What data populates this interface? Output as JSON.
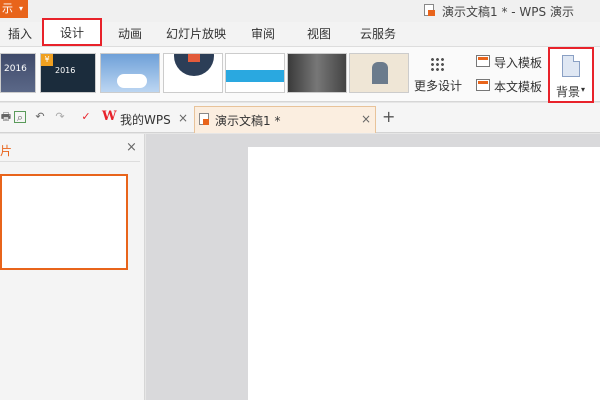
{
  "titlebar": {
    "app_button_label": "示",
    "app_button_arrow": "▾",
    "title": "演示文稿1 * - WPS 演示"
  },
  "menu": {
    "tabs": [
      {
        "label": "插入"
      },
      {
        "label": "设计"
      },
      {
        "label": "动画"
      },
      {
        "label": "幻灯片放映"
      },
      {
        "label": "审阅"
      },
      {
        "label": "视图"
      },
      {
        "label": "云服务"
      }
    ]
  },
  "ribbon": {
    "thumbnails": [
      {
        "text": "2016"
      },
      {
        "text": "2016",
        "badge": "¥"
      },
      {
        "text": ""
      },
      {
        "text": ""
      },
      {
        "text": ""
      },
      {
        "text": ""
      },
      {
        "text": ""
      }
    ],
    "more_design_label": "更多设计",
    "import_template_label": "导入模板",
    "text_template_label": "本文模板",
    "background_label": "背景",
    "background_caret": "▾"
  },
  "toolbar": {
    "print_icon": "🖶",
    "preview_icon": "⌕",
    "undo_icon": "↶",
    "redo_icon": "↷",
    "customize_icon": "✓",
    "wps_logo": "W",
    "wps_tab_label": "我的WPS",
    "doc_tab_label": "演示文稿1 *",
    "close_glyph": "×",
    "new_tab_glyph": "+"
  },
  "left_panel": {
    "title": "片",
    "close_glyph": "×"
  },
  "colors": {
    "accent_orange": "#e8641b",
    "highlight_red": "#e8222a"
  }
}
